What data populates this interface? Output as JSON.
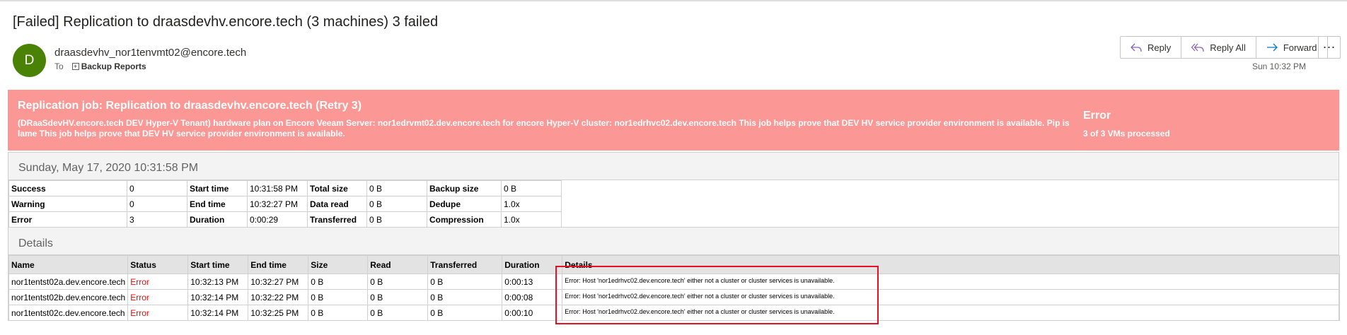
{
  "subject": "[Failed] Replication to draasdevhv.encore.tech (3 machines) 3 failed",
  "sender": {
    "initial": "D",
    "address": "draasdevhv_nor1tenvmt02@encore.tech",
    "to_label": "To",
    "recipient": "Backup Reports",
    "avatar_color": "#498205"
  },
  "actions": {
    "reply": "Reply",
    "reply_all": "Reply All",
    "forward": "Forward",
    "more": "⋯"
  },
  "timestamp": "Sun 10:32 PM",
  "banner": {
    "title": "Replication job: Replication to draasdevhv.encore.tech (Retry 3)",
    "description": "(DRaaSdevHV.encore.tech DEV Hyper-V Tenant) hardware plan on Encore Veeam Server: nor1edrvmt02.dev.encore.tech for encore Hyper-V cluster: nor1edrhvc02.dev.encore.tech This job helps prove that DEV HV service provider environment is available. Pip is lame This job helps prove that DEV HV service provider environment is available.",
    "status": "Error",
    "processed": "3 of 3 VMs processed",
    "color": "#fb9895"
  },
  "session_date": "Sunday, May 17, 2020 10:31:58 PM",
  "summary": [
    [
      "Success",
      "0",
      "Start time",
      "10:31:58 PM",
      "Total size",
      "0 B",
      "Backup size",
      "0 B"
    ],
    [
      "Warning",
      "0",
      "End time",
      "10:32:27 PM",
      "Data read",
      "0 B",
      "Dedupe",
      "1.0x"
    ],
    [
      "Error",
      "3",
      "Duration",
      "0:00:29",
      "Transferred",
      "0 B",
      "Compression",
      "1.0x"
    ]
  ],
  "details_title": "Details",
  "details": {
    "columns": [
      "Name",
      "Status",
      "Start time",
      "End time",
      "Size",
      "Read",
      "Transferred",
      "Duration",
      "Details"
    ],
    "rows": [
      [
        "nor1tentst02a.dev.encore.tech",
        "Error",
        "10:32:13 PM",
        "10:32:27 PM",
        "0 B",
        "0 B",
        "0 B",
        "0:00:13",
        "Error: Host 'nor1edrhvc02.dev.encore.tech' either not a cluster or cluster services is unavailable."
      ],
      [
        "nor1tentst02b.dev.encore.tech",
        "Error",
        "10:32:14 PM",
        "10:32:22 PM",
        "0 B",
        "0 B",
        "0 B",
        "0:00:08",
        "Error: Host 'nor1edrhvc02.dev.encore.tech' either not a cluster or cluster services is unavailable."
      ],
      [
        "nor1tentst02c.dev.encore.tech",
        "Error",
        "10:32:14 PM",
        "10:32:25 PM",
        "0 B",
        "0 B",
        "0 B",
        "0:00:10",
        "Error: Host 'nor1edrhvc02.dev.encore.tech' either not a cluster or cluster services is unavailable."
      ]
    ]
  }
}
